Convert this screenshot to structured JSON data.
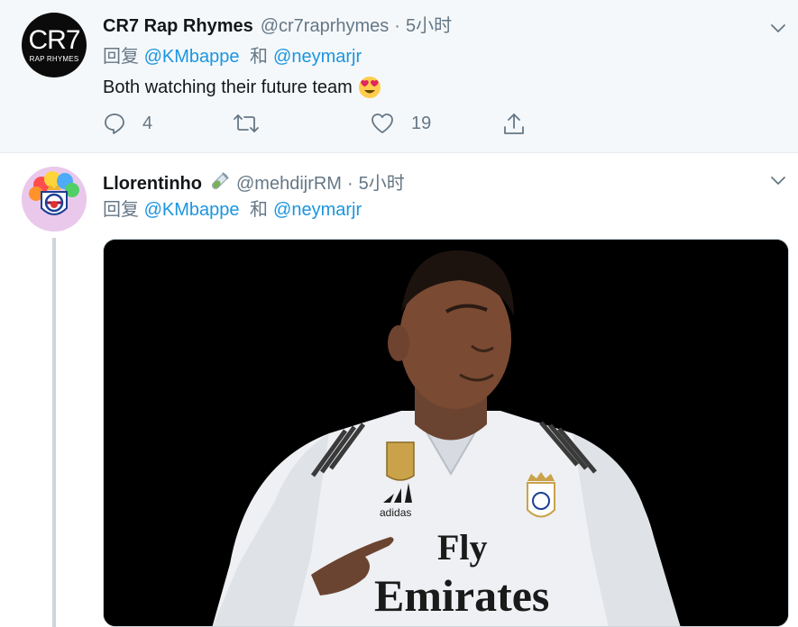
{
  "tweets": [
    {
      "name": "CR7 Rap Rhymes",
      "handle": "@cr7raprhymes",
      "separator": "·",
      "time": "5小时",
      "avatar_text": "CR7",
      "avatar_subtext": "RAP RHYMES",
      "reply_prefix": "回复",
      "mention1": "@KMbappe",
      "conjunction": "和",
      "mention2": "@neymarjr",
      "text": "Both watching their future team",
      "emoji": "smiling-face-with-heart-eyes",
      "reply_count": "4",
      "retweet_count": "",
      "like_count": "19"
    },
    {
      "name": "Llorentinho",
      "name_emoji": "test-tube",
      "handle": "@mehdijrRM",
      "separator": "·",
      "time": "5小时",
      "reply_prefix": "回复",
      "mention1": "@KMbappe",
      "conjunction": "和",
      "mention2": "@neymarjr",
      "media_text_1": "Fly",
      "media_text_2": "Emirates",
      "media_text_3": "adidas"
    }
  ],
  "colors": {
    "link": "#1b95e0",
    "secondary": "#657786",
    "primary_text": "#14171a",
    "highlight_bg": "#f5f8fa"
  }
}
